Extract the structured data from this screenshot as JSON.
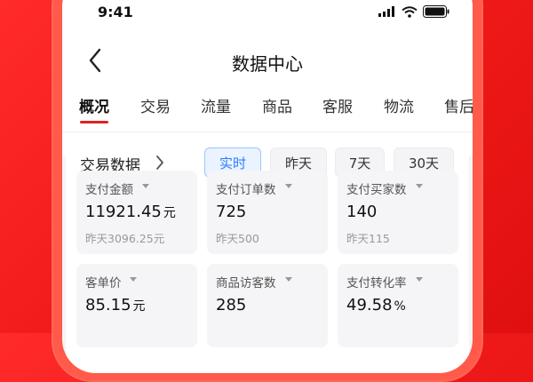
{
  "status": {
    "time": "9:41"
  },
  "header": {
    "title": "数据中心"
  },
  "tabs": [
    "概况",
    "交易",
    "流量",
    "商品",
    "客服",
    "物流",
    "售后"
  ],
  "section": {
    "title": "交易数据",
    "ranges": [
      {
        "label": "实时",
        "active": true
      },
      {
        "label": "昨天",
        "active": false
      },
      {
        "label": "7天",
        "active": false
      },
      {
        "label": "30天",
        "active": false
      }
    ]
  },
  "metrics": [
    {
      "label": "支付金额",
      "value": "11921.45",
      "unit": "元",
      "sub": "昨天3096.25元"
    },
    {
      "label": "支付订单数",
      "value": "725",
      "unit": "",
      "sub": "昨天500"
    },
    {
      "label": "支付买家数",
      "value": "140",
      "unit": "",
      "sub": "昨天115"
    },
    {
      "label": "客单价",
      "value": "85.15",
      "unit": "元",
      "sub": ""
    },
    {
      "label": "商品访客数",
      "value": "285",
      "unit": "",
      "sub": ""
    },
    {
      "label": "支付转化率",
      "value": "49.58",
      "unit": "%",
      "sub": ""
    }
  ],
  "colors": {
    "brand": "#f21b1b",
    "accent": "#2b7cff",
    "active_tab_underline": "#e02020"
  }
}
